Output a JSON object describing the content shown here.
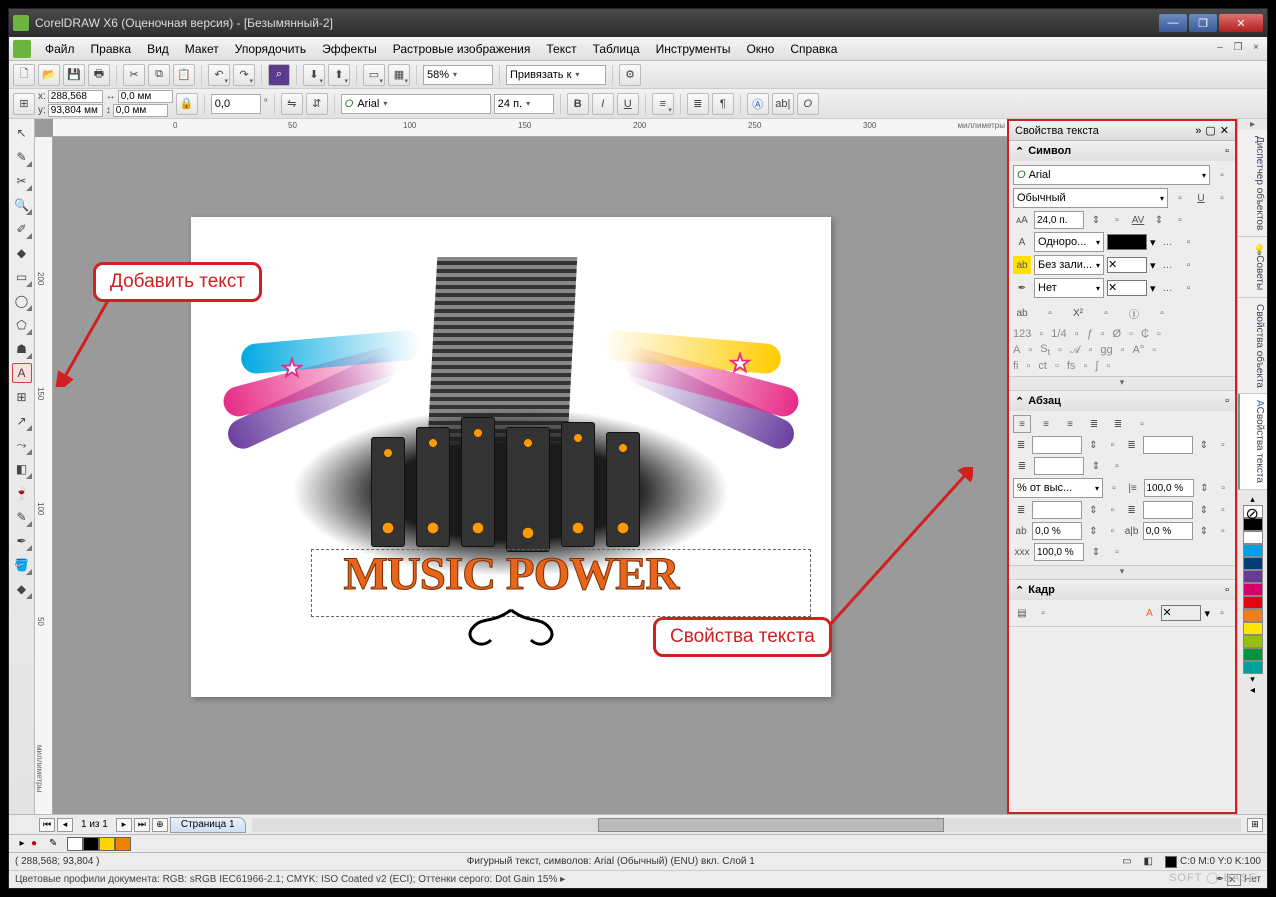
{
  "app": {
    "title": "CorelDRAW X6 (Оценочная версия) - [Безымянный-2]"
  },
  "menu": [
    "Файл",
    "Правка",
    "Вид",
    "Макет",
    "Упорядочить",
    "Эффекты",
    "Растровые изображения",
    "Текст",
    "Таблица",
    "Инструменты",
    "Окно",
    "Справка"
  ],
  "toolbar": {
    "zoom": "58%",
    "snap": "Привязать к"
  },
  "propbar": {
    "x": "288,568 мм",
    "y": "93,804 мм",
    "w": "0,0 мм",
    "h": "0,0 мм",
    "angle": "0,0",
    "font": "Arial",
    "size": "24 п."
  },
  "ruler": {
    "hticks": [
      "0",
      "50",
      "100",
      "150",
      "200",
      "250",
      "300"
    ],
    "vticks": [
      "50",
      "100",
      "150",
      "200"
    ],
    "unit": "миллиметры"
  },
  "canvas": {
    "art_text": "MUSIC POWER"
  },
  "annotations": {
    "add_text": "Добавить текст",
    "text_props": "Свойства текста"
  },
  "docker": {
    "title": "Свойства текста",
    "sections": {
      "symbol": {
        "name": "Символ",
        "font": "Arial",
        "style": "Обычный",
        "size": "24,0 п.",
        "fill_type": "Одноро...",
        "bg_type": "Без зали...",
        "outline": "Нет"
      },
      "paragraph": {
        "name": "Абзац",
        "scale_mode": "% от выс...",
        "line_spacing": "100,0 %",
        "char_spacing": "0,0 %",
        "word_spacing": "0,0 %",
        "lang_spacing": "100,0 %"
      },
      "frame": {
        "name": "Кадр"
      }
    }
  },
  "rtabs": [
    "Диспетчер объектов",
    "Советы",
    "Свойства объекта",
    "Свойства текста"
  ],
  "palette": [
    "#000000",
    "#ffffff",
    "#00a0e3",
    "#003d7a",
    "#6a3b96",
    "#d6006c",
    "#e20613",
    "#ef7f1a",
    "#ffe600",
    "#97bf0d",
    "#009640",
    "#00a19a"
  ],
  "nav": {
    "page_of": "1 из 1",
    "tab": "Страница 1"
  },
  "swatches": [
    "#ffffff",
    "#000000",
    "#ffd400",
    "#f08000"
  ],
  "status": {
    "coords": "( 288,568; 93,804 )",
    "obj": "Фигурный текст, символов: Arial (Обычный) (ENU) вкл. Слой 1",
    "fill": "C:0 M:0 Y:0 K:100",
    "outline": "Нет",
    "profiles": "Цветовые профили документа: RGB: sRGB IEC61966-2.1; CMYK: ISO Coated v2 (ECI); Оттенки серого: Dot Gain 15% ▸"
  },
  "watermark": "SOFT ◯ BASE"
}
